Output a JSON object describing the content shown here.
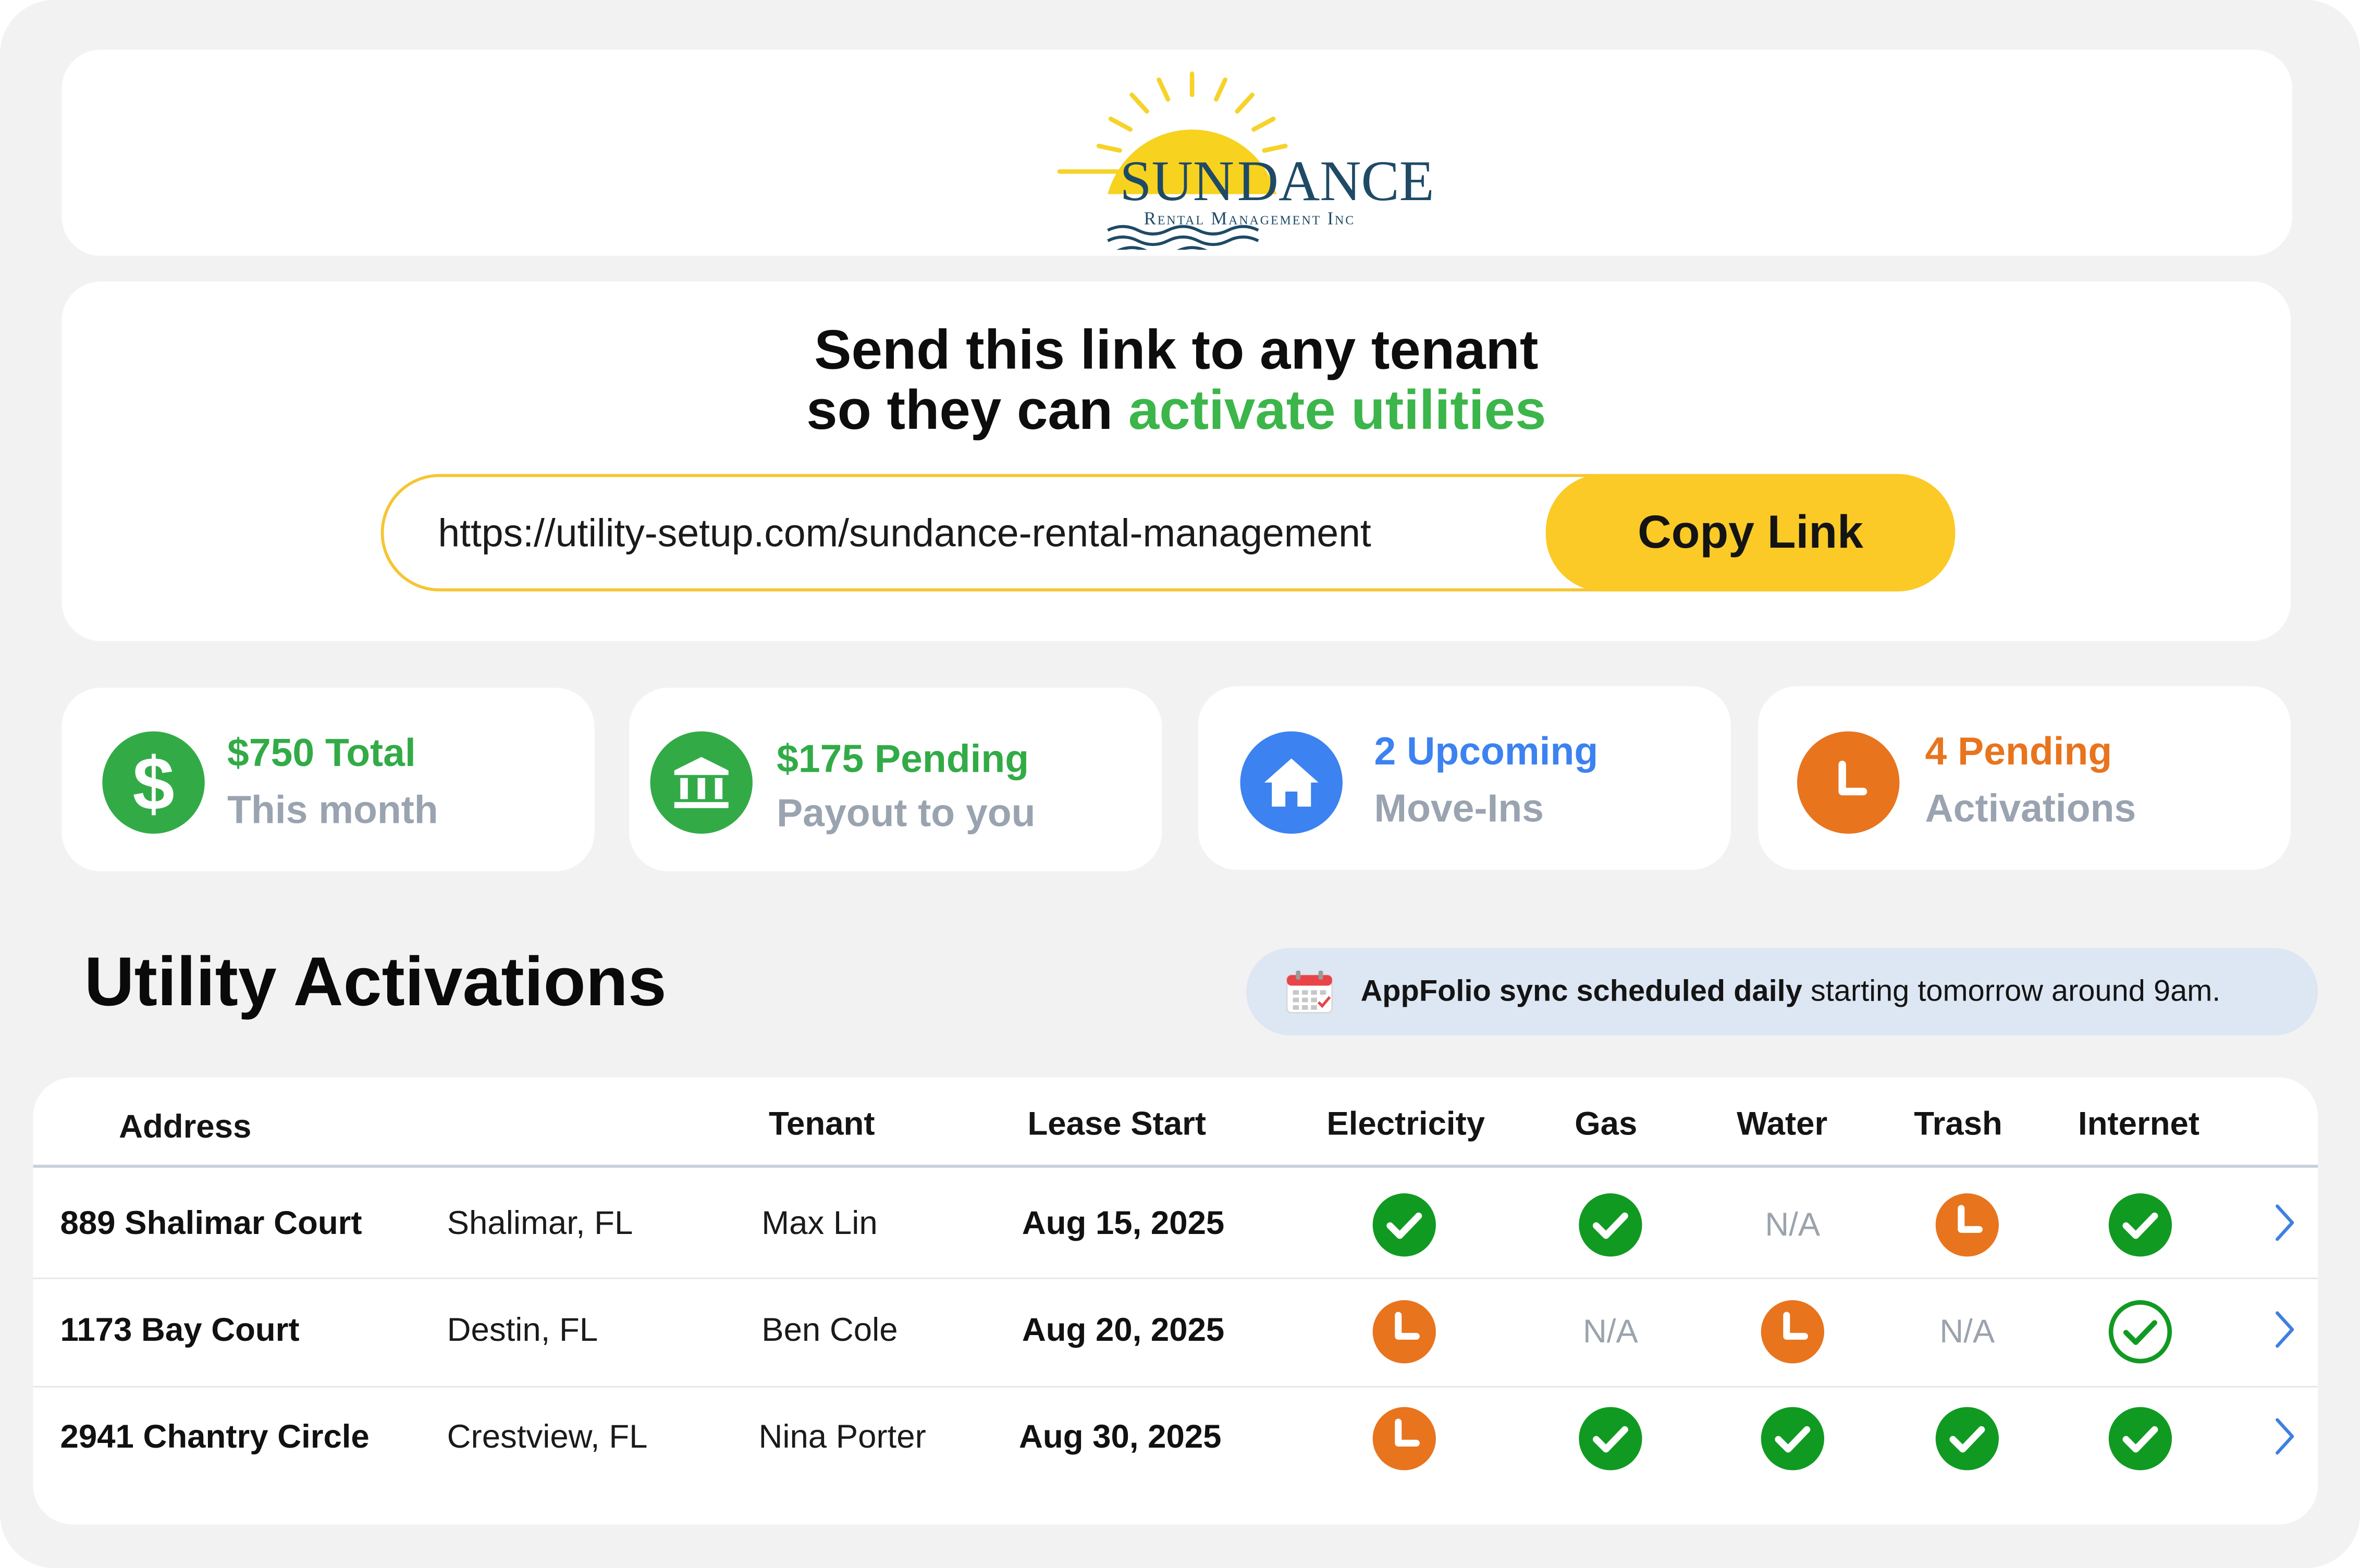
{
  "brand": {
    "logo_text_sun": "SUN",
    "logo_text_dance": "DANCE",
    "logo_subtitle": "Rental Management Inc",
    "colors": {
      "yellow": "#f6d32a",
      "navy": "#1f4a66",
      "green": "#3cb54a"
    }
  },
  "share": {
    "title_line1": "Send this link to any tenant",
    "title_line2_prefix": "so they can ",
    "title_line2_accent": "activate utilities",
    "link_url": "https://utility-setup.com/sundance-rental-management",
    "copy_button_label": "Copy Link"
  },
  "stats": [
    {
      "icon": "dollar-icon",
      "value": "$750 Total",
      "label": "This month",
      "color": "#32ab47"
    },
    {
      "icon": "bank-icon",
      "value": "$175 Pending",
      "label": "Payout to you",
      "color": "#32ab47"
    },
    {
      "icon": "house-icon",
      "value": "2 Upcoming",
      "label": "Move-Ins",
      "color": "#3c82f0"
    },
    {
      "icon": "clock-icon",
      "value": "4 Pending",
      "label": "Activations",
      "color": "#e8741e"
    }
  ],
  "section": {
    "title": "Utility Activations",
    "sync_bold": "AppFolio sync scheduled daily",
    "sync_rest": " starting tomorrow around 9am."
  },
  "table": {
    "columns": [
      "Address",
      "Tenant",
      "Lease Start",
      "Electricity",
      "Gas",
      "Water",
      "Trash",
      "Internet"
    ],
    "na_text": "N/A",
    "rows": [
      {
        "address": "889 Shalimar Court",
        "city": "Shalimar, FL",
        "tenant": "Max Lin",
        "lease_start": "Aug 15, 2025",
        "status": [
          "done",
          "done",
          "na",
          "pending",
          "done"
        ]
      },
      {
        "address": "1173 Bay Court",
        "city": "Destin, FL",
        "tenant": "Ben Cole",
        "lease_start": "Aug 20, 2025",
        "status": [
          "pending",
          "na",
          "pending",
          "na",
          "done-outline"
        ]
      },
      {
        "address": "2941 Chantry Circle",
        "city": "Crestview, FL",
        "tenant": "Nina Porter",
        "lease_start": "Aug 30, 2025",
        "status": [
          "pending",
          "done",
          "done",
          "done",
          "done"
        ]
      }
    ]
  },
  "status_colors": {
    "done": "#119a22",
    "pending": "#e8741e",
    "na": "#9ba3ad",
    "chevron": "#3f7fe0"
  }
}
